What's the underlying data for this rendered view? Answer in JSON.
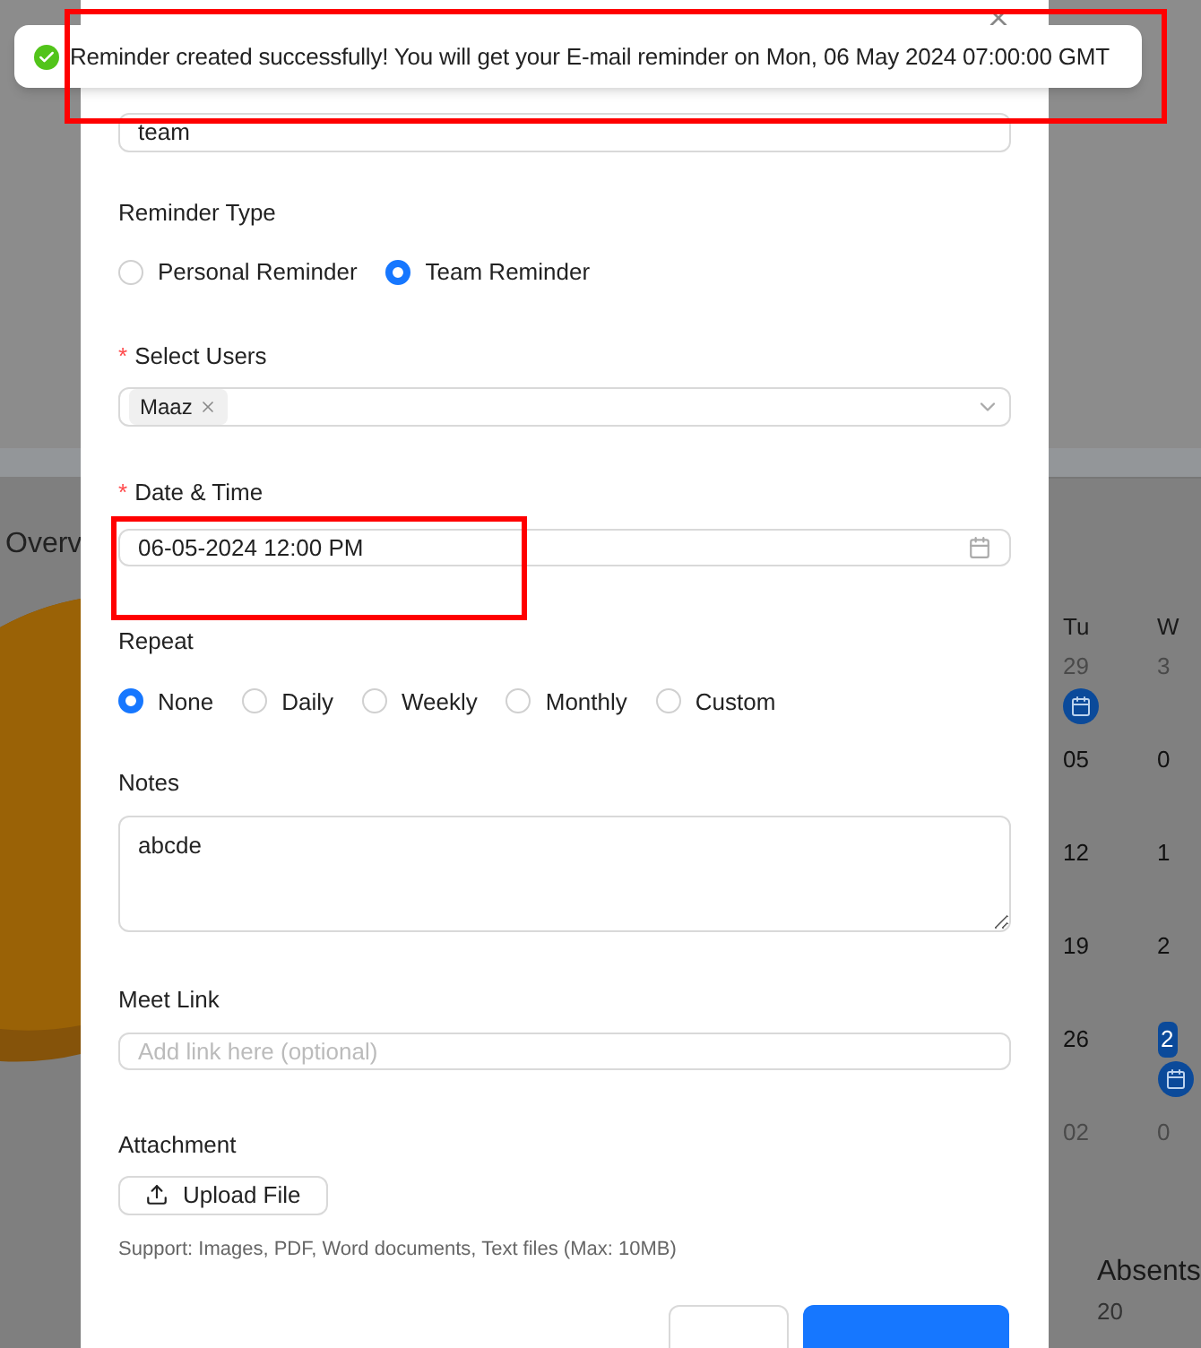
{
  "toast": {
    "kind": "success",
    "message": "Reminder created successfully! You will get your E-mail reminder on Mon, 06 May 2024 07:00:00 GMT"
  },
  "highlights": {
    "toast": true,
    "date_time": true
  },
  "background": {
    "overview_title": "Overv",
    "calendar": {
      "columns": [
        {
          "header": "Tu",
          "days": [
            {
              "label": "29",
              "muted": true,
              "event": true,
              "selected": false
            },
            {
              "label": "05",
              "muted": false,
              "event": false,
              "selected": false
            },
            {
              "label": "12",
              "muted": false,
              "event": false,
              "selected": false
            },
            {
              "label": "19",
              "muted": false,
              "event": false,
              "selected": false
            },
            {
              "label": "26",
              "muted": false,
              "event": false,
              "selected": false
            },
            {
              "label": "02",
              "muted": true,
              "event": false,
              "selected": false
            }
          ]
        },
        {
          "header": "W",
          "days": [
            {
              "label": "3",
              "muted": true,
              "event": false,
              "selected": false
            },
            {
              "label": "0",
              "muted": false,
              "event": false,
              "selected": false
            },
            {
              "label": "1",
              "muted": false,
              "event": false,
              "selected": false
            },
            {
              "label": "2",
              "muted": false,
              "event": false,
              "selected": false
            },
            {
              "label": "2",
              "muted": false,
              "event": true,
              "selected": true
            },
            {
              "label": "0",
              "muted": true,
              "event": false,
              "selected": false
            }
          ]
        }
      ]
    },
    "absents": {
      "label": "Absents",
      "value": "20"
    }
  },
  "form": {
    "title_value": "team",
    "reminder_type": {
      "label": "Reminder Type",
      "options": [
        {
          "label": "Personal Reminder",
          "selected": false
        },
        {
          "label": "Team Reminder",
          "selected": true
        }
      ]
    },
    "select_users": {
      "label": "Select Users",
      "required_mark": "*",
      "tags": [
        "Maaz"
      ]
    },
    "date_time": {
      "label": "Date & Time",
      "required_mark": "*",
      "value": "06-05-2024 12:00 PM"
    },
    "repeat": {
      "label": "Repeat",
      "options": [
        {
          "label": "None",
          "selected": true
        },
        {
          "label": "Daily",
          "selected": false
        },
        {
          "label": "Weekly",
          "selected": false
        },
        {
          "label": "Monthly",
          "selected": false
        },
        {
          "label": "Custom",
          "selected": false
        }
      ]
    },
    "notes": {
      "label": "Notes",
      "value": "abcde"
    },
    "meet_link": {
      "label": "Meet Link",
      "placeholder": "Add link here (optional)"
    },
    "attachment": {
      "label": "Attachment",
      "button": "Upload File",
      "hint": "Support: Images, PDF, Word documents, Text files (Max: 10MB)"
    }
  }
}
